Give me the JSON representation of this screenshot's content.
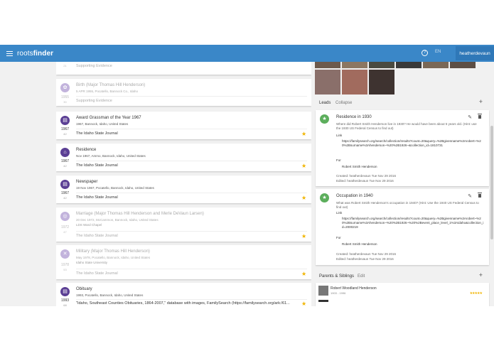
{
  "app": {
    "brand_part1": "roots",
    "brand_part2": "finder",
    "lang": "EN",
    "user": "heatherdevaun",
    "help": "?"
  },
  "colors": {
    "topbar": "#3a87c8",
    "accent": "#5b3f94",
    "lead_icon": "#5cae5c",
    "star": "#f0b400"
  },
  "timeline": [
    {
      "year": "1946",
      "age": "21",
      "title": "",
      "meta": "",
      "meta2": "",
      "source": "Supporting Evidence",
      "source_link": false,
      "faded": true,
      "star": false,
      "icon": "book-icon"
    },
    {
      "year": "1955",
      "age": "30",
      "title": "Birth (Major Thomas Hill Henderson)",
      "meta": "5 APR 1955, Pocatello, Bannock Co., Idaho",
      "meta2": "",
      "source": "Supporting Evidence",
      "source_link": false,
      "faded": true,
      "star": false,
      "icon": "baby-icon"
    },
    {
      "year": "1967",
      "age": "42",
      "title": "Award Grassman of the Year 1967",
      "meta": "1967, Bannock, Idaho, United States",
      "meta2": "",
      "source": "The Idaho State Journal",
      "source_link": false,
      "faded": false,
      "star": true,
      "icon": "book-icon"
    },
    {
      "year": "1967",
      "age": "42",
      "title": "Residence",
      "meta": "Nov 1967, Ammo, Bannock, Idaho, United States",
      "meta2": "",
      "source": "The Idaho State Journal",
      "source_link": false,
      "faded": false,
      "star": true,
      "icon": "home-icon"
    },
    {
      "year": "1967",
      "age": "42",
      "title": "Newspaper",
      "meta": "19 Nov 1967, Pocatello, Bannock, Idaho, United States",
      "meta2": "",
      "source": "The Idaho State Journal",
      "source_link": false,
      "faded": false,
      "star": true,
      "icon": "book-icon"
    },
    {
      "year": "1972",
      "age": "47",
      "title": "Marriage (Major Thomas Hill Henderson and Merle DeVaun Larsen)",
      "meta": "20 Dec 1972, McCammon, Bannock, Idaho, United States",
      "meta2": "LDS Ward Chapel",
      "source": "The Idaho State Journal",
      "source_link": false,
      "faded": true,
      "star": true,
      "icon": "rings-icon"
    },
    {
      "year": "1978",
      "age": "53",
      "title": "Military (Major Thomas Hill Henderson)",
      "meta": "May 1978, Pocatello, Bannock, Idaho, United States",
      "meta2": "Idaho State University",
      "source": "The Idaho State Journal",
      "source_link": false,
      "faded": true,
      "star": true,
      "icon": "swords-icon"
    },
    {
      "year": "1993",
      "age": "68",
      "title": "Obituary",
      "meta": "1993, Pocatello, Bannock, Idaho, United States",
      "meta2": "",
      "source": "\"Idaho, Southeast Counties Obituaries, 1864-2007,\" database with images, FamilySearch (https://familysearch.org/ark:/61...",
      "source_link": false,
      "faded": false,
      "star": true,
      "icon": "book-icon"
    }
  ],
  "leads_section": {
    "title": "Leads",
    "action": "Collapse",
    "add": "+"
  },
  "leads": [
    {
      "title": "Residence in 1930",
      "question": "Where did Robert Smith Henderson live in 1930? He would have been about 5 years old. (Hint: use the 1930 US Federal Census to find out)",
      "link_label": "Link",
      "url": "https://familysearch.org/search/collection/results?count=20&query=%2Bgivenname%3Arobert~%20%2Bsurname%3Ahenderson~%20%2B1926~&collection_id=1810731",
      "for_label": "For",
      "for_person": "Robert Smith Henderson",
      "created": "Created: heatherdevaun Tue Nov 29 2016",
      "edited": "Edited: heatherdevaun Tue Nov 29 2016"
    },
    {
      "title": "Occupation in 1940",
      "question": "What was Robert Smith Henderson's occupation in 1940? (Hint: Use the 1940 US Federal Census to find out)",
      "link_label": "Link",
      "url": "https://familysearch.org/search/collection/results?count=20&query=%2Bgivenname%3Arobert~%20%2Bsurname%3Ahenderson~%20%2B1926~%20%2Bevent_place_level_1%3Aidaho&collection_id=2000219",
      "for_label": "For",
      "for_person": "Robert Smith Henderson",
      "created": "Created: heatherdevaun Tue Nov 29 2016",
      "edited": "Edited: heatherdevaun Tue Nov 29 2016"
    }
  ],
  "parents_section": {
    "title": "Parents & Siblings",
    "action": "Edit",
    "add": "+"
  },
  "parents": [
    {
      "name": "Robert Woodland Henderson",
      "dates": "1903 - 1996"
    }
  ]
}
